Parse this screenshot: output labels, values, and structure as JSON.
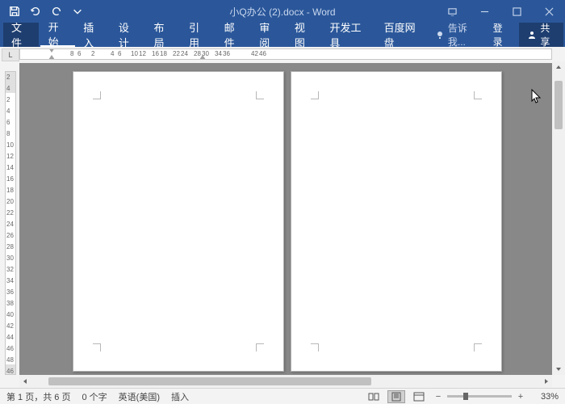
{
  "title": "小Q办公 (2).docx - Word",
  "ribbon": {
    "file": "文件",
    "tabs": [
      "开始",
      "插入",
      "设计",
      "布局",
      "引用",
      "邮件",
      "审阅",
      "视图",
      "开发工具",
      "百度网盘"
    ],
    "tellme": "告诉我...",
    "login": "登录",
    "share": "共享"
  },
  "hruler_ticks": [
    "8",
    "6",
    "2",
    "4",
    "6",
    "10",
    "12",
    "16",
    "18",
    "22",
    "24",
    "28",
    "30",
    "34",
    "36",
    "42",
    "46"
  ],
  "hruler_positions": [
    0,
    9,
    26,
    50,
    59,
    75,
    85,
    101,
    111,
    127,
    137,
    153,
    163,
    179,
    189,
    224,
    234
  ],
  "vruler_ticks": [
    "2",
    "4",
    "2",
    "4",
    "6",
    "8",
    "10",
    "12",
    "14",
    "16",
    "18",
    "20",
    "22",
    "24",
    "26",
    "28",
    "30",
    "32",
    "34",
    "36",
    "38",
    "40",
    "42",
    "44",
    "46",
    "48",
    "46"
  ],
  "ruler_corner": "L",
  "statusbar": {
    "page": "第 1 页，共 6 页",
    "words": "0 个字",
    "lang": "英语(美国)",
    "mode": "插入",
    "record": "",
    "zoom": "33%"
  },
  "zoom_buttons": {
    "minus": "−",
    "plus": "+"
  }
}
